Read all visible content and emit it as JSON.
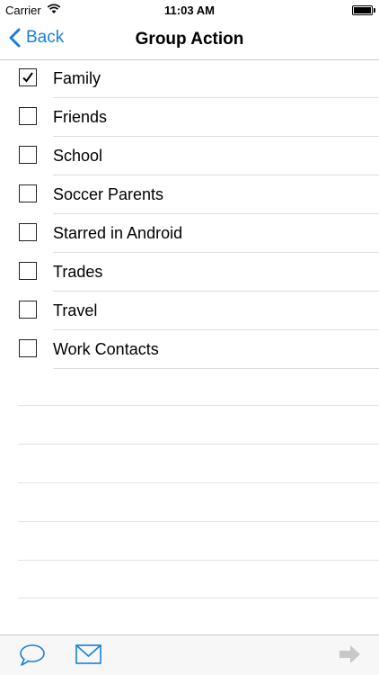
{
  "status_bar": {
    "carrier": "Carrier",
    "time": "11:03 AM",
    "wifi_icon": "wifi-icon",
    "battery_icon": "battery-icon"
  },
  "nav": {
    "back_label": "Back",
    "title": "Group Action",
    "accent_color": "#1a7fd6"
  },
  "groups": [
    {
      "label": "Family",
      "checked": true
    },
    {
      "label": "Friends",
      "checked": false
    },
    {
      "label": "School",
      "checked": false
    },
    {
      "label": "Soccer Parents",
      "checked": false
    },
    {
      "label": "Starred in Android",
      "checked": false
    },
    {
      "label": "Trades",
      "checked": false
    },
    {
      "label": "Travel",
      "checked": false
    },
    {
      "label": "Work Contacts",
      "checked": false
    }
  ],
  "toolbar": {
    "message_icon": "speech-bubble-icon",
    "email_icon": "envelope-icon",
    "forward_icon": "arrow-right-icon",
    "forward_enabled": false
  }
}
